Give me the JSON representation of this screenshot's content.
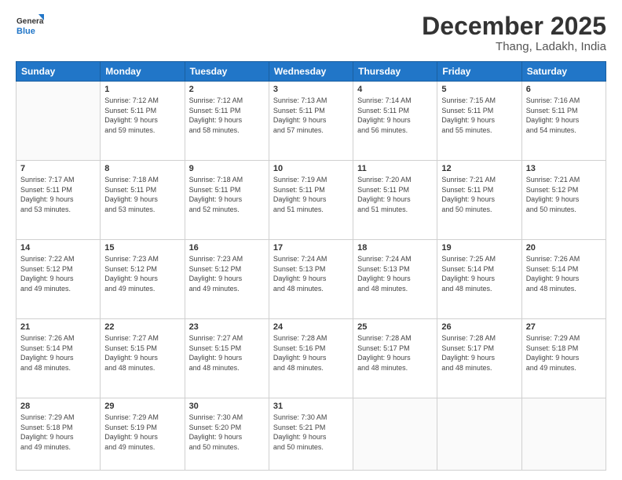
{
  "header": {
    "logo_line1": "General",
    "logo_line2": "Blue",
    "month": "December 2025",
    "location": "Thang, Ladakh, India"
  },
  "days_of_week": [
    "Sunday",
    "Monday",
    "Tuesday",
    "Wednesday",
    "Thursday",
    "Friday",
    "Saturday"
  ],
  "weeks": [
    [
      {
        "day": "",
        "info": ""
      },
      {
        "day": "1",
        "info": "Sunrise: 7:12 AM\nSunset: 5:11 PM\nDaylight: 9 hours\nand 59 minutes."
      },
      {
        "day": "2",
        "info": "Sunrise: 7:12 AM\nSunset: 5:11 PM\nDaylight: 9 hours\nand 58 minutes."
      },
      {
        "day": "3",
        "info": "Sunrise: 7:13 AM\nSunset: 5:11 PM\nDaylight: 9 hours\nand 57 minutes."
      },
      {
        "day": "4",
        "info": "Sunrise: 7:14 AM\nSunset: 5:11 PM\nDaylight: 9 hours\nand 56 minutes."
      },
      {
        "day": "5",
        "info": "Sunrise: 7:15 AM\nSunset: 5:11 PM\nDaylight: 9 hours\nand 55 minutes."
      },
      {
        "day": "6",
        "info": "Sunrise: 7:16 AM\nSunset: 5:11 PM\nDaylight: 9 hours\nand 54 minutes."
      }
    ],
    [
      {
        "day": "7",
        "info": "Sunrise: 7:17 AM\nSunset: 5:11 PM\nDaylight: 9 hours\nand 53 minutes."
      },
      {
        "day": "8",
        "info": "Sunrise: 7:18 AM\nSunset: 5:11 PM\nDaylight: 9 hours\nand 53 minutes."
      },
      {
        "day": "9",
        "info": "Sunrise: 7:18 AM\nSunset: 5:11 PM\nDaylight: 9 hours\nand 52 minutes."
      },
      {
        "day": "10",
        "info": "Sunrise: 7:19 AM\nSunset: 5:11 PM\nDaylight: 9 hours\nand 51 minutes."
      },
      {
        "day": "11",
        "info": "Sunrise: 7:20 AM\nSunset: 5:11 PM\nDaylight: 9 hours\nand 51 minutes."
      },
      {
        "day": "12",
        "info": "Sunrise: 7:21 AM\nSunset: 5:11 PM\nDaylight: 9 hours\nand 50 minutes."
      },
      {
        "day": "13",
        "info": "Sunrise: 7:21 AM\nSunset: 5:12 PM\nDaylight: 9 hours\nand 50 minutes."
      }
    ],
    [
      {
        "day": "14",
        "info": "Sunrise: 7:22 AM\nSunset: 5:12 PM\nDaylight: 9 hours\nand 49 minutes."
      },
      {
        "day": "15",
        "info": "Sunrise: 7:23 AM\nSunset: 5:12 PM\nDaylight: 9 hours\nand 49 minutes."
      },
      {
        "day": "16",
        "info": "Sunrise: 7:23 AM\nSunset: 5:12 PM\nDaylight: 9 hours\nand 49 minutes."
      },
      {
        "day": "17",
        "info": "Sunrise: 7:24 AM\nSunset: 5:13 PM\nDaylight: 9 hours\nand 48 minutes."
      },
      {
        "day": "18",
        "info": "Sunrise: 7:24 AM\nSunset: 5:13 PM\nDaylight: 9 hours\nand 48 minutes."
      },
      {
        "day": "19",
        "info": "Sunrise: 7:25 AM\nSunset: 5:14 PM\nDaylight: 9 hours\nand 48 minutes."
      },
      {
        "day": "20",
        "info": "Sunrise: 7:26 AM\nSunset: 5:14 PM\nDaylight: 9 hours\nand 48 minutes."
      }
    ],
    [
      {
        "day": "21",
        "info": "Sunrise: 7:26 AM\nSunset: 5:14 PM\nDaylight: 9 hours\nand 48 minutes."
      },
      {
        "day": "22",
        "info": "Sunrise: 7:27 AM\nSunset: 5:15 PM\nDaylight: 9 hours\nand 48 minutes."
      },
      {
        "day": "23",
        "info": "Sunrise: 7:27 AM\nSunset: 5:15 PM\nDaylight: 9 hours\nand 48 minutes."
      },
      {
        "day": "24",
        "info": "Sunrise: 7:28 AM\nSunset: 5:16 PM\nDaylight: 9 hours\nand 48 minutes."
      },
      {
        "day": "25",
        "info": "Sunrise: 7:28 AM\nSunset: 5:17 PM\nDaylight: 9 hours\nand 48 minutes."
      },
      {
        "day": "26",
        "info": "Sunrise: 7:28 AM\nSunset: 5:17 PM\nDaylight: 9 hours\nand 48 minutes."
      },
      {
        "day": "27",
        "info": "Sunrise: 7:29 AM\nSunset: 5:18 PM\nDaylight: 9 hours\nand 49 minutes."
      }
    ],
    [
      {
        "day": "28",
        "info": "Sunrise: 7:29 AM\nSunset: 5:18 PM\nDaylight: 9 hours\nand 49 minutes."
      },
      {
        "day": "29",
        "info": "Sunrise: 7:29 AM\nSunset: 5:19 PM\nDaylight: 9 hours\nand 49 minutes."
      },
      {
        "day": "30",
        "info": "Sunrise: 7:30 AM\nSunset: 5:20 PM\nDaylight: 9 hours\nand 50 minutes."
      },
      {
        "day": "31",
        "info": "Sunrise: 7:30 AM\nSunset: 5:21 PM\nDaylight: 9 hours\nand 50 minutes."
      },
      {
        "day": "",
        "info": ""
      },
      {
        "day": "",
        "info": ""
      },
      {
        "day": "",
        "info": ""
      }
    ]
  ]
}
